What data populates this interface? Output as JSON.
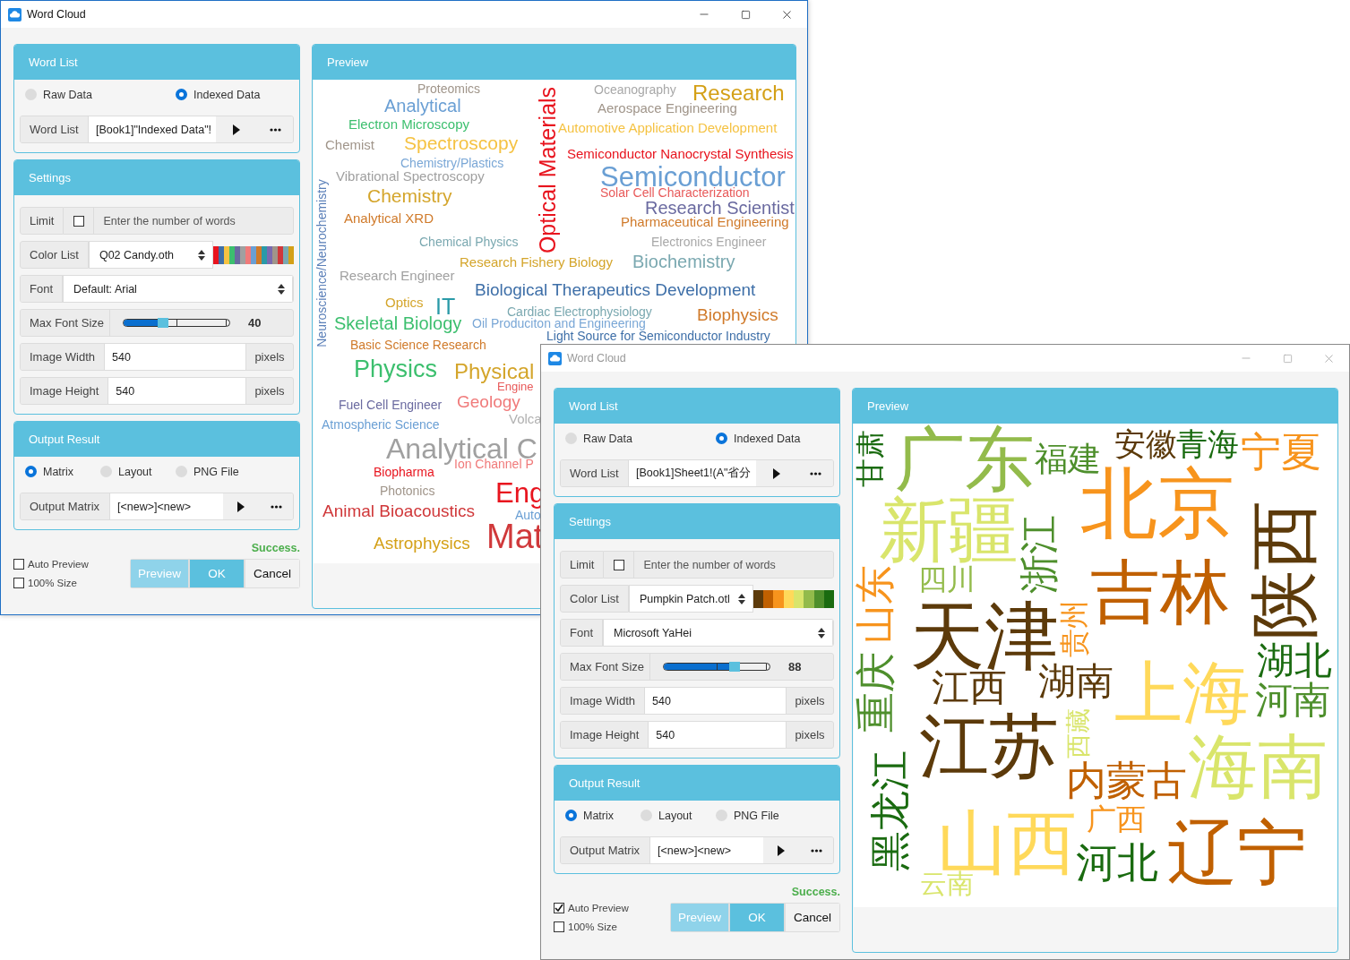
{
  "windows": [
    {
      "title": "Word Cloud",
      "active": true,
      "word_list": {
        "title": "Word List",
        "sources": [
          {
            "label": "Raw Data",
            "selected": false
          },
          {
            "label": "Indexed Data",
            "selected": true
          }
        ],
        "field_label": "Word List",
        "field_value": "[Book1]\"Indexed Data\"!"
      },
      "settings": {
        "title": "Settings",
        "limit": {
          "label": "Limit",
          "checked": false,
          "placeholder": "Enter the number of words"
        },
        "color_list": {
          "label": "Color List",
          "value": "Q02 Candy.oth",
          "swatches": [
            {
              "color": "#e8141e"
            },
            {
              "color": "#3e6fa8"
            },
            {
              "color": "#f5c242"
            },
            {
              "color": "#3cbf6e"
            },
            {
              "color": "#6a6aa0"
            },
            {
              "color": "#a0a0a0"
            },
            {
              "color": "#f07a7a"
            },
            {
              "color": "#6a9fd4"
            },
            {
              "color": "#d07a2a"
            },
            {
              "color": "#2a9aa8"
            },
            {
              "color": "#7a6ab0"
            },
            {
              "color": "#a0958a"
            },
            {
              "color": "#d0383a"
            },
            {
              "color": "#7aa8b0"
            },
            {
              "color": "#d4a017"
            }
          ]
        },
        "font": {
          "label": "Font",
          "value": "Default: Arial"
        },
        "max_font_size": {
          "label": "Max Font Size",
          "level": 0.33,
          "reading": "40"
        },
        "image_width": {
          "label": "Image Width",
          "value": "540",
          "unit": "pixels"
        },
        "image_height": {
          "label": "Image Height",
          "value": "540",
          "unit": "pixels"
        }
      },
      "output": {
        "title": "Output Result",
        "options": [
          {
            "label": "Matrix",
            "selected": true
          },
          {
            "label": "Layout",
            "selected": false
          },
          {
            "label": "PNG File",
            "selected": false
          }
        ],
        "field_label": "Output Matrix",
        "field_value": "[<new>]<new>"
      },
      "status": "Success.",
      "options": [
        {
          "label": "Auto Preview",
          "checked": false
        },
        {
          "label": "100% Size",
          "checked": false
        }
      ],
      "buttons": [
        {
          "label": "Preview",
          "kind": "preview"
        },
        {
          "label": "OK",
          "kind": "primary"
        },
        {
          "label": "Cancel",
          "kind": "default"
        }
      ],
      "preview": {
        "title": "Preview",
        "words": [
          {
            "text": "Proteomics",
            "color": "#a0958a"
          },
          {
            "text": "Analytical",
            "color": "#6a9fd4"
          },
          {
            "text": "Electron Microscopy",
            "color": "#3cbf6e"
          },
          {
            "text": "Chemist",
            "color": "#a0958a"
          },
          {
            "text": "Spectroscopy",
            "color": "#f5c242"
          },
          {
            "text": "Chemistry/Plastics",
            "color": "#7aa7d6"
          },
          {
            "text": "Vibrational Spectroscopy",
            "color": "#a0a0a0"
          },
          {
            "text": "Chemistry",
            "color": "#d4a52b"
          },
          {
            "text": "Analytical XRD",
            "color": "#d07a2a"
          },
          {
            "text": "Chemical Physics",
            "color": "#7aa8b0"
          },
          {
            "text": "Optical Materials",
            "color": "#e8141e"
          },
          {
            "text": "Neuroscience/Neurochemistry",
            "color": "#5a7fb8"
          },
          {
            "text": "Oceanography",
            "color": "#a8a8a8"
          },
          {
            "text": "Research",
            "color": "#d4a017"
          },
          {
            "text": "Aerospace Engineering",
            "color": "#a0958a"
          },
          {
            "text": "Automotive Application Development",
            "color": "#f5c242"
          },
          {
            "text": "Semiconductor Nanocrystal Synthesis",
            "color": "#e8141e"
          },
          {
            "text": "Semiconductor",
            "color": "#6a9fd4"
          },
          {
            "text": "Solar Cell Characterization",
            "color": "#e85a5a"
          },
          {
            "text": "Research Scientist",
            "color": "#6a6aa0"
          },
          {
            "text": "Pharmaceutical Engineering",
            "color": "#d07a2a"
          },
          {
            "text": "Electronics Engineer",
            "color": "#a8a8a8"
          },
          {
            "text": "Research Fishery Biology",
            "color": "#d4a52b"
          },
          {
            "text": "Biochemistry",
            "color": "#7aa8b0"
          },
          {
            "text": "Research Engineer",
            "color": "#a0a0a0"
          },
          {
            "text": "Biological Therapeutics Development",
            "color": "#3e6fa8"
          },
          {
            "text": "Optics",
            "color": "#d4a52b"
          },
          {
            "text": "IT",
            "color": "#2a9aa8"
          },
          {
            "text": "Cardiac Electrophysiology",
            "color": "#7aa8b0"
          },
          {
            "text": "Biophysics",
            "color": "#d07a2a"
          },
          {
            "text": "Skeletal Biology",
            "color": "#3cbf6e"
          },
          {
            "text": "Oil Produciton and Engineering",
            "color": "#7aa7d6"
          },
          {
            "text": "Light Source for Semiconductor Industry",
            "color": "#3e6fa8"
          },
          {
            "text": "Basic Science Research",
            "color": "#d07a2a"
          },
          {
            "text": "Physics",
            "color": "#3cbf6e"
          },
          {
            "text": "Physical",
            "color": "#d4a52b"
          },
          {
            "text": "Engine",
            "color": "#e85a5a"
          },
          {
            "text": "Geology",
            "color": "#f07a7a"
          },
          {
            "text": "Fuel Cell Engineer",
            "color": "#6a6aa0"
          },
          {
            "text": "Volca",
            "color": "#b0b0b0"
          },
          {
            "text": "Atmospheric Science",
            "color": "#6a9fd4"
          },
          {
            "text": "Analytical C",
            "color": "#a0a0a0"
          },
          {
            "text": "Ion Channel P",
            "color": "#f07a7a"
          },
          {
            "text": "Biopharma",
            "color": "#e8141e"
          },
          {
            "text": "Photonics",
            "color": "#a0958a"
          },
          {
            "text": "Eng",
            "color": "#e8141e"
          },
          {
            "text": "Animal Bioacoustics",
            "color": "#d0383a"
          },
          {
            "text": "Auto",
            "color": "#6a9fd4"
          },
          {
            "text": "Astrophysics",
            "color": "#d4a017"
          },
          {
            "text": "Mat",
            "color": "#d0383a"
          }
        ]
      }
    },
    {
      "title": "Word Cloud",
      "active": false,
      "word_list": {
        "title": "Word List",
        "sources": [
          {
            "label": "Raw Data",
            "selected": false
          },
          {
            "label": "Indexed Data",
            "selected": true
          }
        ],
        "field_label": "Word List",
        "field_value": "[Book1]Sheet1!(A\"省分"
      },
      "settings": {
        "title": "Settings",
        "limit": {
          "label": "Limit",
          "checked": false,
          "placeholder": "Enter the number of words"
        },
        "color_list": {
          "label": "Color List",
          "value": "Pumpkin Patch.otl",
          "swatches": [
            {
              "color": "#5c3a0a"
            },
            {
              "color": "#c06000"
            },
            {
              "color": "#f7941d"
            },
            {
              "color": "#ffd95a"
            },
            {
              "color": "#d9e56b"
            },
            {
              "color": "#93bb4b"
            },
            {
              "color": "#4e8f2c"
            },
            {
              "color": "#1a6b10"
            }
          ]
        },
        "font": {
          "label": "Font",
          "value": "Microsoft YaHei"
        },
        "max_font_size": {
          "label": "Max Font Size",
          "level": 0.63,
          "reading": "88"
        },
        "image_width": {
          "label": "Image Width",
          "value": "540",
          "unit": "pixels"
        },
        "image_height": {
          "label": "Image Height",
          "value": "540",
          "unit": "pixels"
        }
      },
      "output": {
        "title": "Output Result",
        "options": [
          {
            "label": "Matrix",
            "selected": true
          },
          {
            "label": "Layout",
            "selected": false
          },
          {
            "label": "PNG File",
            "selected": false
          }
        ],
        "field_label": "Output Matrix",
        "field_value": "[<new>]<new>"
      },
      "status": "Success.",
      "options": [
        {
          "label": "Auto Preview",
          "checked": true
        },
        {
          "label": "100% Size",
          "checked": false
        }
      ],
      "buttons": [
        {
          "label": "Preview",
          "kind": "preview"
        },
        {
          "label": "OK",
          "kind": "primary"
        },
        {
          "label": "Cancel",
          "kind": "default"
        }
      ],
      "preview": {
        "title": "Preview",
        "words": [
          {
            "text": "甘肃",
            "color": "#1a6b10"
          },
          {
            "text": "广东",
            "color": "#93bb4b"
          },
          {
            "text": "福建",
            "color": "#4e8f2c"
          },
          {
            "text": "安徽",
            "color": "#5c3a0a"
          },
          {
            "text": "青海",
            "color": "#1a6b10"
          },
          {
            "text": "宁夏",
            "color": "#f7941d"
          },
          {
            "text": "新疆",
            "color": "#d9e56b"
          },
          {
            "text": "北京",
            "color": "#f7941d"
          },
          {
            "text": "浙江",
            "color": "#4e8f2c"
          },
          {
            "text": "四川",
            "color": "#93bb4b"
          },
          {
            "text": "陕西",
            "color": "#5c3a0a"
          },
          {
            "text": "吉林",
            "color": "#c06000"
          },
          {
            "text": "山东",
            "color": "#f7941d"
          },
          {
            "text": "天津",
            "color": "#5c3a0a"
          },
          {
            "text": "贵州",
            "color": "#f7941d"
          },
          {
            "text": "江西",
            "color": "#5c3a0a"
          },
          {
            "text": "湖南",
            "color": "#5c3a0a"
          },
          {
            "text": "上海",
            "color": "#ffd95a"
          },
          {
            "text": "湖北",
            "color": "#1a6b10"
          },
          {
            "text": "河南",
            "color": "#4e8f2c"
          },
          {
            "text": "重庆",
            "color": "#4e8f2c"
          },
          {
            "text": "西藏",
            "color": "#d9e56b"
          },
          {
            "text": "江苏",
            "color": "#5c3a0a"
          },
          {
            "text": "黑龙江",
            "color": "#1a6b10"
          },
          {
            "text": "内蒙古",
            "color": "#c06000"
          },
          {
            "text": "海南",
            "color": "#d9e56b"
          },
          {
            "text": "山西",
            "color": "#ffd95a"
          },
          {
            "text": "广西",
            "color": "#f7941d"
          },
          {
            "text": "河北",
            "color": "#1a6b10"
          },
          {
            "text": "辽宁",
            "color": "#c06000"
          },
          {
            "text": "云南",
            "color": "#d9e56b"
          }
        ]
      }
    }
  ]
}
